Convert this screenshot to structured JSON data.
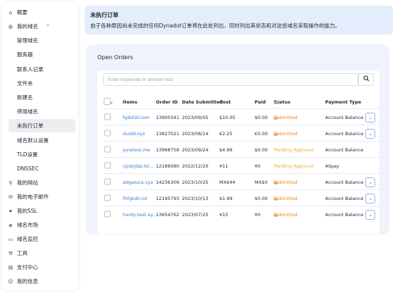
{
  "sidebar": {
    "items": [
      {
        "label": "概要",
        "icon": "home-icon",
        "glyph": "⌂",
        "level": "top"
      },
      {
        "label": "我的域名",
        "icon": "globe-icon",
        "glyph": "◍",
        "level": "top",
        "expanded": true
      },
      {
        "label": "管理域名",
        "level": "sub"
      },
      {
        "label": "服务器",
        "level": "sub"
      },
      {
        "label": "联系人记录",
        "level": "sub"
      },
      {
        "label": "文件夹",
        "level": "sub"
      },
      {
        "label": "新建名",
        "level": "sub"
      },
      {
        "label": "停用域名",
        "level": "sub"
      },
      {
        "label": "未执行订单",
        "level": "sub",
        "active": true
      },
      {
        "label": "域名默认设置",
        "level": "sub"
      },
      {
        "label": "TLD设置",
        "level": "sub"
      },
      {
        "label": "DNSSEC",
        "level": "sub"
      },
      {
        "label": "我的网站",
        "icon": "link-icon",
        "glyph": "⚲",
        "level": "top"
      },
      {
        "label": "我的电子邮件",
        "icon": "mail-icon",
        "glyph": "✉",
        "level": "top"
      },
      {
        "label": "我的SSL",
        "icon": "lock-icon",
        "glyph": "🔒︎",
        "level": "top"
      },
      {
        "label": "域名市场",
        "icon": "tag-icon",
        "glyph": "◈",
        "level": "top"
      },
      {
        "label": "域名监控",
        "icon": "monitor-icon",
        "glyph": "▭",
        "level": "top"
      },
      {
        "label": "工具",
        "icon": "wrench-icon",
        "glyph": "⚒",
        "level": "top"
      },
      {
        "label": "支付中心",
        "icon": "calendar-icon",
        "glyph": "▤",
        "level": "top"
      },
      {
        "label": "我的信息",
        "icon": "user-icon",
        "glyph": "☺",
        "level": "top"
      }
    ]
  },
  "banner": {
    "title": "未执行订单",
    "description": "由于各种原因尚未完成的任何Dynadot订单将在此处列出，同时列出其状态和对这些域名采取操作的能力。"
  },
  "orders": {
    "title": "Open Orders",
    "search_placeholder": "Enter keywords or domain lists",
    "columns": [
      "Items",
      "Order ID",
      "Date Submitted",
      "Cost",
      "Paid",
      "Status",
      "Payment Type"
    ],
    "rows": [
      {
        "item": "fgdsfaf.com",
        "order_id": "13900341",
        "date": "2023/09/05",
        "cost": "$10.05",
        "paid": "$0.00",
        "status": "Submitted",
        "payment": "Account Balance",
        "expand": true
      },
      {
        "item": "duidd.xyz",
        "order_id": "13827021",
        "date": "2023/08/14",
        "cost": "€2.25",
        "paid": "€0.00",
        "status": "Submitted",
        "payment": "Account Balance",
        "expand": true
      },
      {
        "item": "junetest.me",
        "order_id": "13968758",
        "date": "2023/09/24",
        "cost": "$4.99",
        "paid": "$0.00",
        "status": "Pending Approval",
        "payment": "Account Balance",
        "expand": false
      },
      {
        "item": "cjzskjdal.lol...",
        "order_id": "12186080",
        "date": "2022/12/20",
        "cost": "¥11",
        "paid": "¥0",
        "status": "Pending Approval",
        "payment": "Alipay",
        "expand": false
      },
      {
        "item": "adgaiuca.xyz",
        "order_id": "14236309",
        "date": "2023/10/25",
        "cost": "MX$44",
        "paid": "MX$0",
        "status": "Submitted",
        "payment": "Account Balance",
        "expand": true
      },
      {
        "item": "fhfgkdh.lol",
        "order_id": "12195793",
        "date": "2023/10/13",
        "cost": "$1.99",
        "paid": "$0.00",
        "status": "Submitted",
        "payment": "Account Balance",
        "expand": true
      },
      {
        "item": "hardy-test.xy...",
        "order_id": "13654762",
        "date": "2023/07/25",
        "cost": "¥15",
        "paid": "¥0",
        "status": "Submitted",
        "payment": "Account Balance",
        "expand": true
      }
    ]
  },
  "colors": {
    "link": "#2d7fd3",
    "submitted": "#e8891d",
    "pending": "#e8a93a",
    "banner_bg": "#e4edfb",
    "panel_bg": "#eef3fc"
  }
}
